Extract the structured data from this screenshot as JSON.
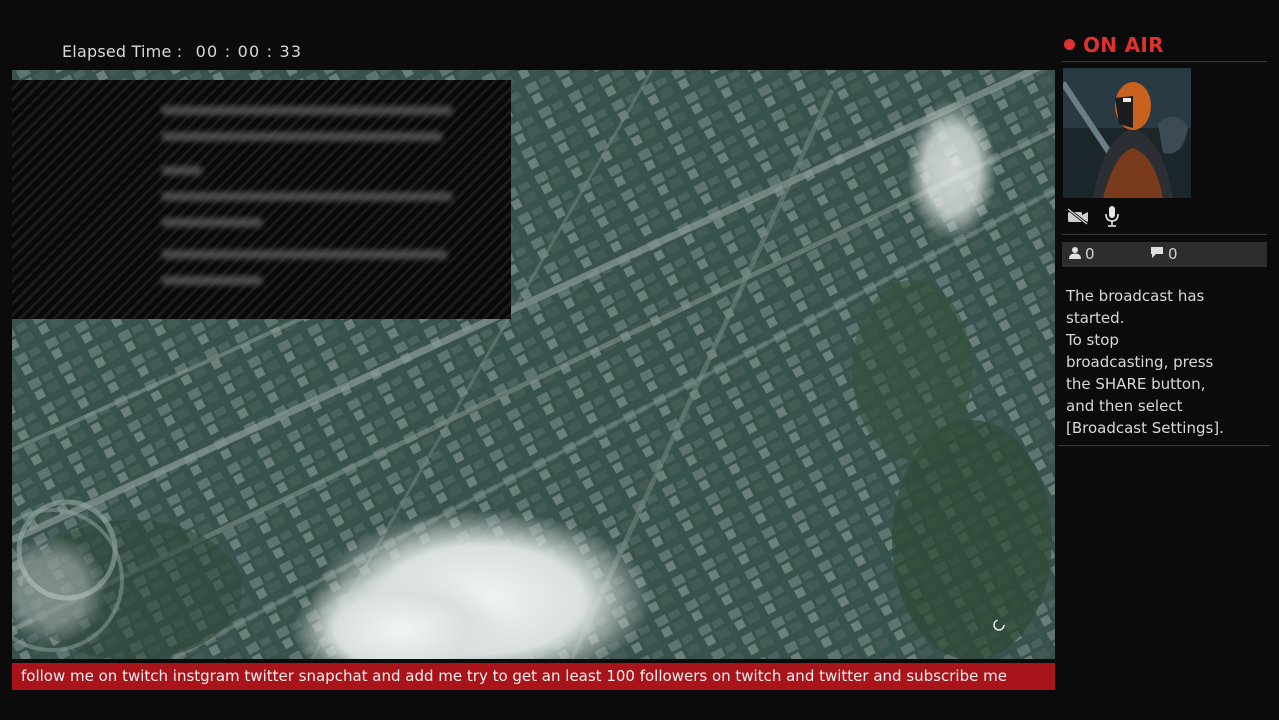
{
  "header": {
    "elapsed_label": "Elapsed Time :",
    "elapsed_value": "00 : 00 : 33"
  },
  "broadcast": {
    "status": "ON AIR",
    "status_color": "#e0322c",
    "viewers": "0",
    "comments": "0",
    "icons": {
      "camera": "camera-off-icon",
      "mic": "microphone-icon",
      "viewers": "person-icon",
      "comments": "speech-bubble-icon"
    },
    "notice_line1": "The broadcast has started.",
    "notice_line2": "To stop broadcasting, press the SHARE button, and then select [Broadcast Settings]."
  },
  "ticker": {
    "text": "follow me on twitch instgram twitter snapchat and add me try to get an least 100 followers on twitch  and twitter and subscribe  me",
    "color": "#a8141a"
  }
}
